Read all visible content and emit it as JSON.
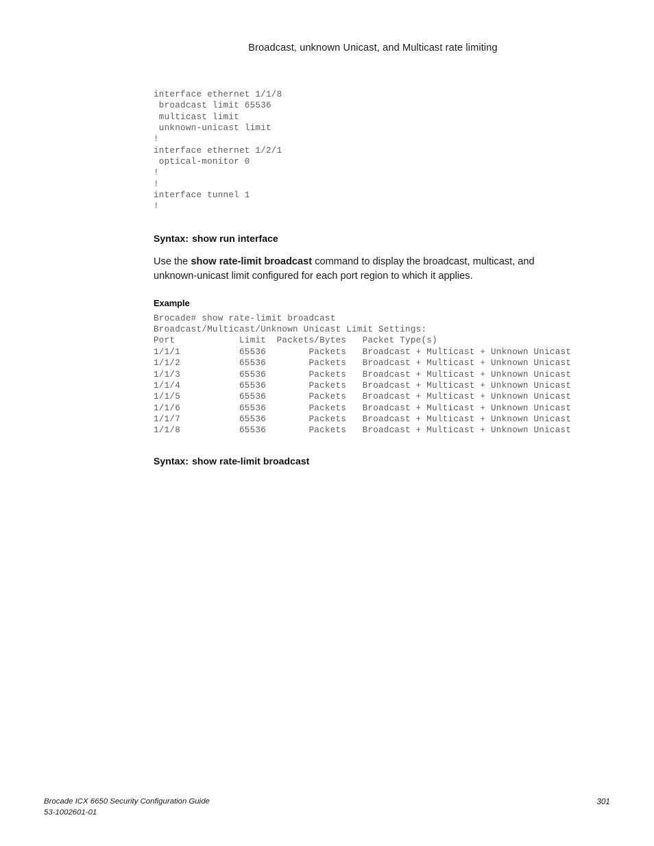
{
  "header": {
    "running_title": "Broadcast, unknown Unicast, and Multicast rate limiting"
  },
  "config_block": {
    "lines": [
      "interface ethernet 1/1/8",
      " broadcast limit 65536",
      " multicast limit",
      " unknown-unicast limit",
      "!",
      "interface ethernet 1/2/1",
      " optical-monitor 0",
      "!",
      "!",
      "interface tunnel 1",
      "!"
    ],
    "text": "interface ethernet 1/1/8\n broadcast limit 65536\n multicast limit\n unknown-unicast limit\n!\ninterface ethernet 1/2/1\n optical-monitor 0\n!\n!\ninterface tunnel 1\n!"
  },
  "syntax_first": {
    "label": "Syntax:",
    "command": "show run interface"
  },
  "paragraph": {
    "lead": "Use the ",
    "bold_command": "show rate-limit broadcast",
    "tail": " command to display the broadcast, multicast, and unknown-unicast limit configured for each port region to which it applies."
  },
  "example": {
    "label": "Example",
    "prompt_line": "Brocade# show rate-limit broadcast",
    "settings_line": "Broadcast/Multicast/Unknown Unicast Limit Settings:",
    "columns": [
      "Port",
      "Limit",
      "Packets/Bytes",
      "Packet Type(s)"
    ],
    "rows": [
      {
        "port": "1/1/1",
        "limit": "65536",
        "packets_bytes": "Packets",
        "packet_types": "Broadcast + Multicast + Unknown Unicast"
      },
      {
        "port": "1/1/2",
        "limit": "65536",
        "packets_bytes": "Packets",
        "packet_types": "Broadcast + Multicast + Unknown Unicast"
      },
      {
        "port": "1/1/3",
        "limit": "65536",
        "packets_bytes": "Packets",
        "packet_types": "Broadcast + Multicast + Unknown Unicast"
      },
      {
        "port": "1/1/4",
        "limit": "65536",
        "packets_bytes": "Packets",
        "packet_types": "Broadcast + Multicast + Unknown Unicast"
      },
      {
        "port": "1/1/5",
        "limit": "65536",
        "packets_bytes": "Packets",
        "packet_types": "Broadcast + Multicast + Unknown Unicast"
      },
      {
        "port": "1/1/6",
        "limit": "65536",
        "packets_bytes": "Packets",
        "packet_types": "Broadcast + Multicast + Unknown Unicast"
      },
      {
        "port": "1/1/7",
        "limit": "65536",
        "packets_bytes": "Packets",
        "packet_types": "Broadcast + Multicast + Unknown Unicast"
      },
      {
        "port": "1/1/8",
        "limit": "65536",
        "packets_bytes": "Packets",
        "packet_types": "Broadcast + Multicast + Unknown Unicast"
      }
    ],
    "text": "Brocade# show rate-limit broadcast\nBroadcast/Multicast/Unknown Unicast Limit Settings:\nPort            Limit  Packets/Bytes   Packet Type(s)\n1/1/1           65536        Packets   Broadcast + Multicast + Unknown Unicast\n1/1/2           65536        Packets   Broadcast + Multicast + Unknown Unicast\n1/1/3           65536        Packets   Broadcast + Multicast + Unknown Unicast\n1/1/4           65536        Packets   Broadcast + Multicast + Unknown Unicast\n1/1/5           65536        Packets   Broadcast + Multicast + Unknown Unicast\n1/1/6           65536        Packets   Broadcast + Multicast + Unknown Unicast\n1/1/7           65536        Packets   Broadcast + Multicast + Unknown Unicast\n1/1/8           65536        Packets   Broadcast + Multicast + Unknown Unicast"
  },
  "syntax_last": {
    "label": "Syntax:",
    "command": "show rate-limit broadcast"
  },
  "footer": {
    "guide_title": "Brocade ICX 6650 Security Configuration Guide",
    "document_number": "53-1002601-01",
    "page_number": "301"
  }
}
